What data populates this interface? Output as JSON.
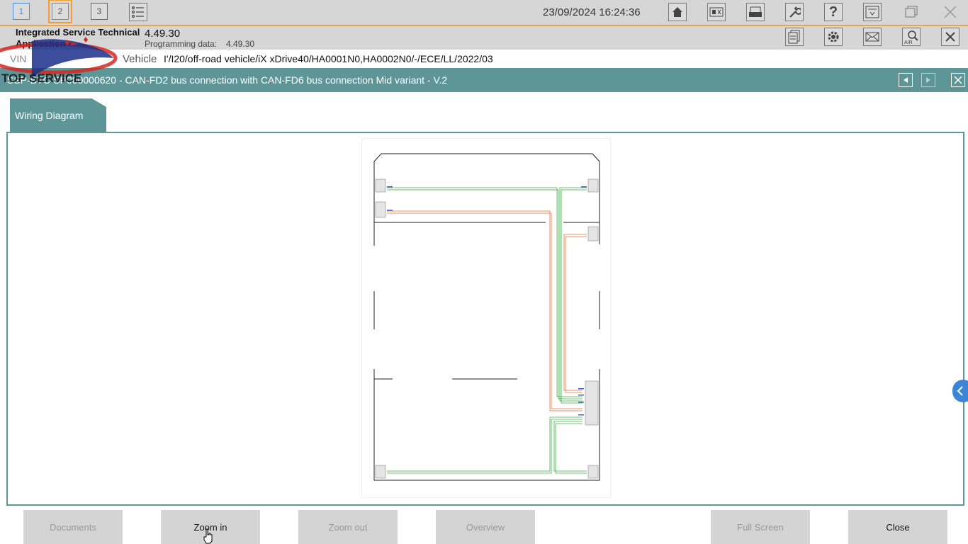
{
  "topbar": {
    "session_tabs": [
      "1",
      "2",
      "3"
    ],
    "datetime": "23/09/2024 16:24:36"
  },
  "app": {
    "name": "Integrated Service Technical Application",
    "version": "4.49.30",
    "programming_data_label": "Programming data:",
    "programming_data_value": "4.49.30"
  },
  "vehicle": {
    "vin_label": "VIN",
    "label": "Vehicle",
    "value": "I'/I20/off-road vehicle/iX xDrive40/HA0001N0,HA0002N0/-/ECE/LL/2022/03"
  },
  "document": {
    "title": "SSP-BTC-SP000000620 - CAN-FD2 bus connection with CAN-FD6 bus connection Mid variant - V.2",
    "tab_label": "Wiring Diagram"
  },
  "logo": {
    "text": "TOP SERVICE"
  },
  "bottom_buttons": [
    {
      "label": "Documents",
      "enabled": false
    },
    {
      "label": "Zoom in",
      "enabled": true
    },
    {
      "label": "Zoom out",
      "enabled": false
    },
    {
      "label": "Overview",
      "enabled": false
    },
    {
      "label": "Full Screen",
      "enabled": false
    },
    {
      "label": "Close",
      "enabled": true
    }
  ],
  "colors": {
    "accent_teal": "#5e9698",
    "active_orange": "#f0a030",
    "wire_green": "#3cb043",
    "wire_orange": "#e8703a"
  }
}
